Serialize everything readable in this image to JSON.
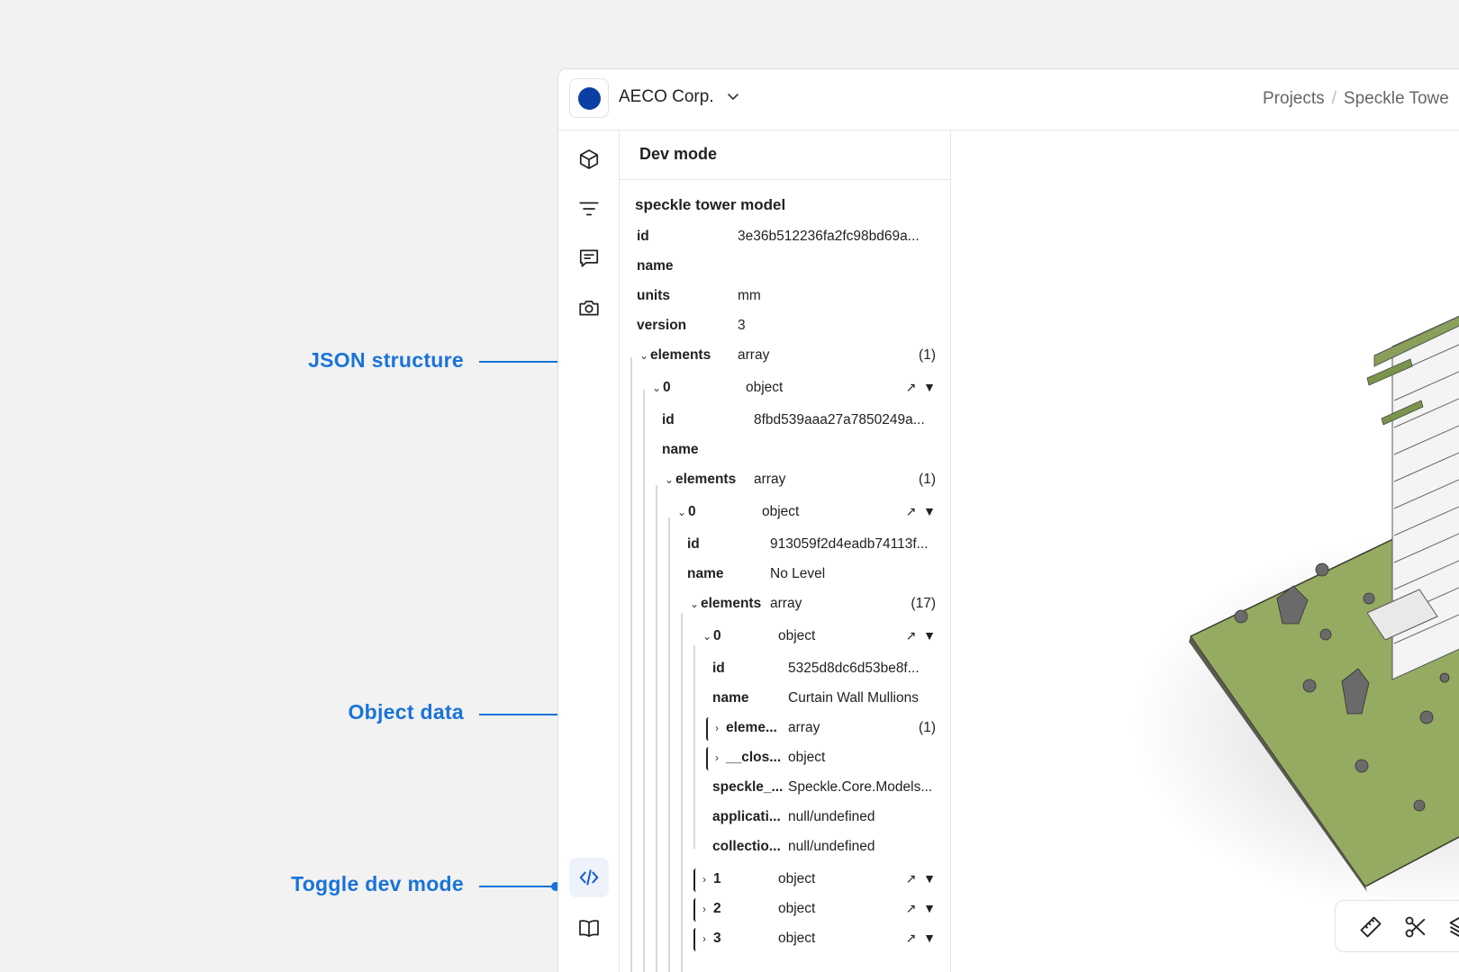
{
  "annotations": {
    "json_structure": "JSON structure",
    "object_data": "Object data",
    "toggle_dev_mode": "Toggle dev mode"
  },
  "workspace": {
    "name": "AECO Corp.",
    "color": "#0c3fa6"
  },
  "breadcrumbs": [
    "Projects",
    "/",
    "Speckle Towe"
  ],
  "rail_icons": [
    "cube-icon",
    "filter-icon",
    "comment-icon",
    "camera-icon",
    "code-icon",
    "book-icon"
  ],
  "panel": {
    "title": "Dev mode",
    "model_name": "speckle tower model",
    "root": {
      "id_key": "id",
      "id": "3e36b512236fa2fc98bd69a...",
      "name_key": "name",
      "units_key": "units",
      "units": "mm",
      "version_key": "version",
      "version": "3",
      "elements_key": "elements",
      "elements_type": "array",
      "elements_count": "(1)"
    },
    "level1": {
      "index": "0",
      "type": "object",
      "id_key": "id",
      "id": "8fbd539aaa27a7850249a...",
      "name_key": "name",
      "elements_key": "elements",
      "elements_type": "array",
      "elements_count": "(1)"
    },
    "level2": {
      "index": "0",
      "type": "object",
      "id_key": "id",
      "id": "913059f2d4eadb74113f...",
      "name_key": "name",
      "name": "No Level",
      "elements_key": "elements",
      "elements_type": "array",
      "elements_count": "(17)"
    },
    "level3": {
      "index": "0",
      "type": "object",
      "id_key": "id",
      "id": "5325d8dc6d53be8f...",
      "name_key": "name",
      "name": "Curtain Wall Mullions",
      "elements_key": "eleme...",
      "elements_type": "array",
      "elements_count": "(1)",
      "closure_key": "__clos...",
      "closure_type": "object",
      "speckle_key": "speckle_...",
      "speckle_value": "Speckle.Core.Models...",
      "app_key": "applicati...",
      "app_value": "null/undefined",
      "coll_key": "collectio...",
      "coll_value": "null/undefined"
    },
    "siblings": [
      {
        "index": "1",
        "type": "object"
      },
      {
        "index": "2",
        "type": "object"
      },
      {
        "index": "3",
        "type": "object"
      }
    ],
    "action_link": "↗",
    "action_filter": "▼"
  },
  "toolbar_icons": [
    "ruler-icon",
    "scissors-icon",
    "layers-icon"
  ]
}
